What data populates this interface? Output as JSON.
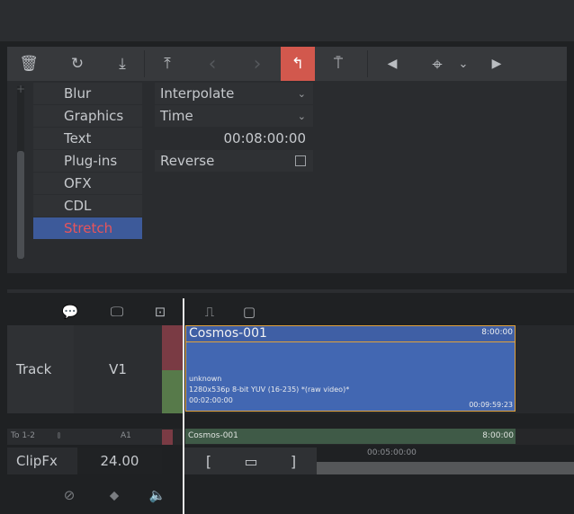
{
  "toolbar": {
    "icons": [
      "trash-icon",
      "reset-icon",
      "download-icon",
      "upload-icon",
      "prev-icon",
      "next-icon",
      "curve-icon",
      "keyframe-icon",
      "play-back-icon",
      "target-icon",
      "chevron-down-icon",
      "play-forward-icon"
    ],
    "glyphs": {
      "trash": "🗑",
      "reset": "↻",
      "download": "⤓",
      "upload": "⤒",
      "prev": "‹",
      "next": "›",
      "curve": "↰",
      "keyframe": "⍑",
      "play_back": "◀",
      "target": "⌖",
      "chevron": "⌄",
      "play_fwd": "▶"
    },
    "active_color": "#d2584d"
  },
  "effects": {
    "plus": "+",
    "categories": [
      "Blur",
      "Graphics",
      "Text",
      "Plug-ins",
      "OFX",
      "CDL",
      "Stretch"
    ],
    "selected": "Stretch",
    "selected_color": "#3d5a9a"
  },
  "properties": {
    "interpolate_label": "Interpolate",
    "time_label": "Time",
    "time_value": "00:08:00:00",
    "reverse_label": "Reverse",
    "reverse_checked": false
  },
  "timeline": {
    "track_label": "Track",
    "track_name": "V1",
    "clip": {
      "title": "Cosmos-001",
      "duration": "8:00:00",
      "line1": "unknown",
      "line2": "1280x536p 8-bit YUV (16-235) *(raw video)*",
      "start_tc": "00:02:00:00",
      "end_tc": "00:09:59:23",
      "color": "#4267b2"
    },
    "audio": {
      "route_label": "To 1-2",
      "track": "A1",
      "clip_title": "Cosmos-001",
      "clip_duration": "8:00:00"
    },
    "clipfx_label": "ClipFx",
    "clipfx_value": "24.00",
    "ruler_tc": "00:05:00:00",
    "trim": {
      "left": "[",
      "mid": "▭",
      "right": "]"
    }
  },
  "bottom": {
    "icons": [
      "eye-off-icon",
      "marker-icon",
      "speaker-icon"
    ],
    "glyphs": {
      "eye_off": "⊘",
      "marker": "⬥",
      "speaker": "🔈"
    }
  },
  "timeline_tools": {
    "glyphs": {
      "comment": "💬",
      "monitor": "🖵",
      "overlay": "⊡",
      "step": "⎍",
      "box": "▢"
    }
  }
}
